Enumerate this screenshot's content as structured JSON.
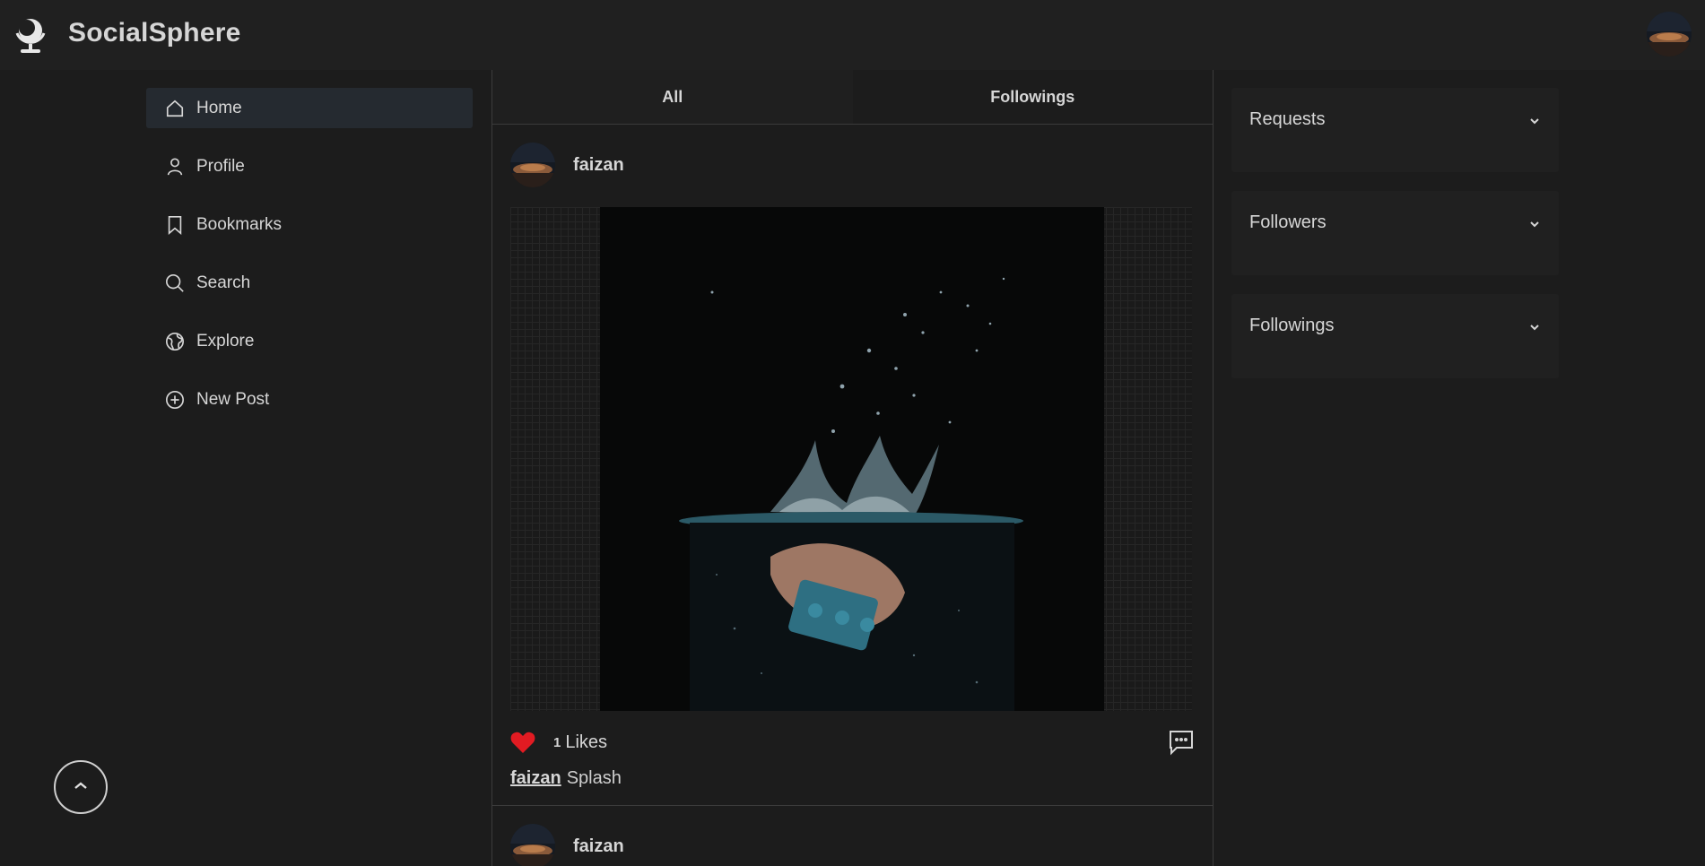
{
  "app": {
    "brand": "SocialSphere"
  },
  "sidebar": {
    "items": [
      {
        "label": "Home",
        "icon": "home-icon",
        "active": true
      },
      {
        "label": "Profile",
        "icon": "user-icon",
        "active": false
      },
      {
        "label": "Bookmarks",
        "icon": "bookmark-icon",
        "active": false
      },
      {
        "label": "Search",
        "icon": "search-icon",
        "active": false
      },
      {
        "label": "Explore",
        "icon": "globe-icon",
        "active": false
      },
      {
        "label": "New Post",
        "icon": "plus-circle-icon",
        "active": false
      }
    ]
  },
  "feed": {
    "tabs": [
      {
        "label": "All",
        "active": true
      },
      {
        "label": "Followings",
        "active": false
      }
    ],
    "posts": [
      {
        "username": "faizan",
        "likes_count": "1",
        "likes_label": "Likes",
        "caption_user": "faizan",
        "caption_text": "Splash"
      },
      {
        "username": "faizan"
      }
    ]
  },
  "right_panel": {
    "sections": [
      {
        "title": "Requests"
      },
      {
        "title": "Followers"
      },
      {
        "title": "Followings"
      }
    ]
  },
  "colors": {
    "background": "#1c1c1c",
    "topbar": "#202020",
    "active_nav": "#252a30",
    "like": "#e11b22"
  }
}
